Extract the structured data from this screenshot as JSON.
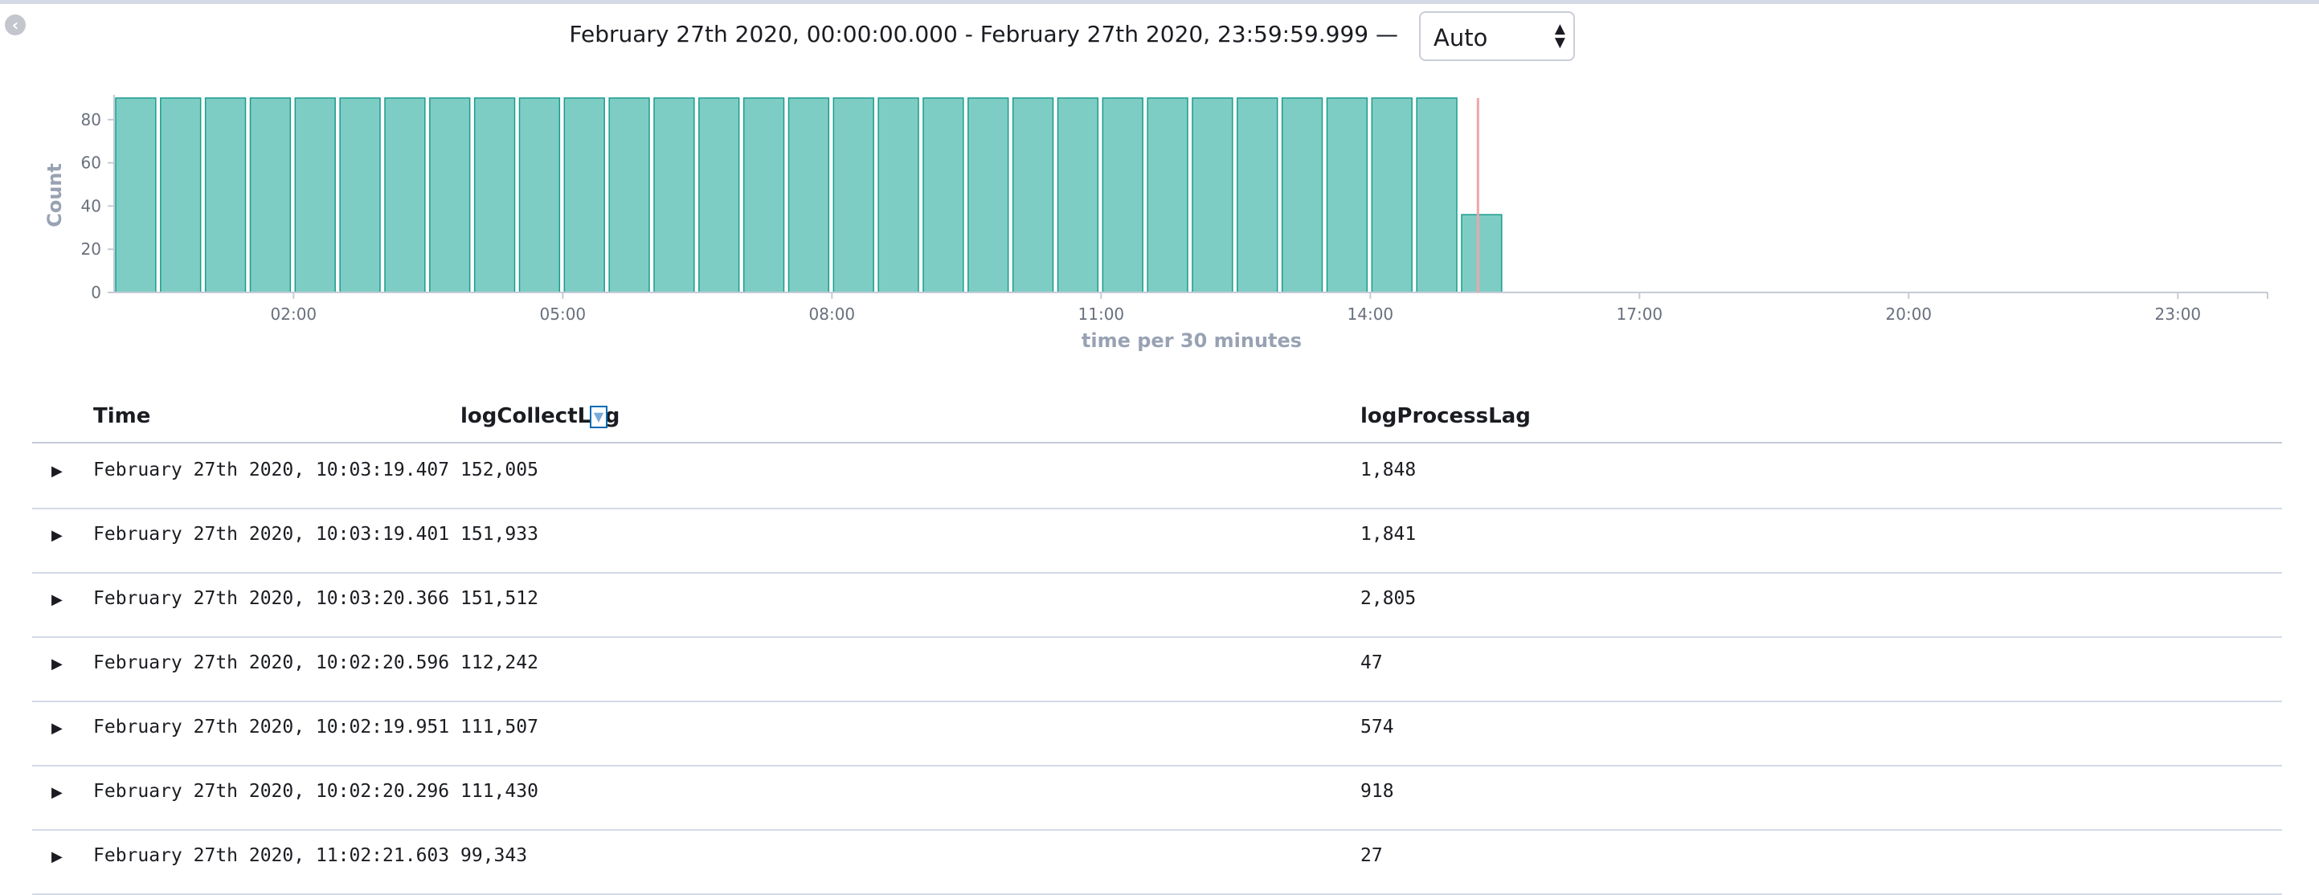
{
  "header": {
    "collapse_icon": "chevron-left-icon",
    "time_range": "February 27th 2020, 00:00:00.000 - February 27th 2020, 23:59:59.999 —",
    "interval": {
      "selected": "Auto",
      "icon": "select-arrows-icon"
    }
  },
  "chart_data": {
    "type": "bar",
    "x_unit": "hours",
    "xlabel": "time per 30 minutes",
    "ylabel": "Count",
    "xlim": [
      0,
      24
    ],
    "ylim": [
      0,
      90
    ],
    "y_ticks": [
      0,
      20,
      40,
      60,
      80
    ],
    "x_ticks": [
      {
        "value": 2,
        "label": "02:00"
      },
      {
        "value": 5,
        "label": "05:00"
      },
      {
        "value": 8,
        "label": "08:00"
      },
      {
        "value": 11,
        "label": "11:00"
      },
      {
        "value": 14,
        "label": "14:00"
      },
      {
        "value": 17,
        "label": "17:00"
      },
      {
        "value": 20,
        "label": "20:00"
      },
      {
        "value": 23,
        "label": "23:00"
      }
    ],
    "bin_width": 0.5,
    "bar_starts": [
      0,
      0.5,
      1,
      1.5,
      2,
      2.5,
      3,
      3.5,
      4,
      4.5,
      5,
      5.5,
      6,
      6.5,
      7,
      7.5,
      8,
      8.5,
      9,
      9.5,
      10,
      10.5,
      11,
      11.5,
      12,
      12.5,
      13,
      13.5,
      14,
      14.5,
      15
    ],
    "values": [
      90,
      90,
      90,
      90,
      90,
      90,
      90,
      90,
      90,
      90,
      90,
      90,
      90,
      90,
      90,
      90,
      90,
      90,
      90,
      90,
      90,
      90,
      90,
      90,
      90,
      90,
      90,
      90,
      90,
      90,
      36
    ],
    "current_time_marker": 15.2,
    "bar_color": "#7ecdc4",
    "bar_border": "#1a9c8e",
    "marker_color": "#f0a5a8",
    "grid": false
  },
  "table": {
    "columns": [
      "Time",
      "logCollectLag",
      "logProcessLag"
    ],
    "sort_icon": "sort-down-icon",
    "expand_icon": "caret-right-icon",
    "rows": [
      {
        "time": "February 27th 2020, 10:03:19.407",
        "logCollectLag": "152,005",
        "logProcessLag": "1,848"
      },
      {
        "time": "February 27th 2020, 10:03:19.401",
        "logCollectLag": "151,933",
        "logProcessLag": "1,841"
      },
      {
        "time": "February 27th 2020, 10:03:20.366",
        "logCollectLag": "151,512",
        "logProcessLag": "2,805"
      },
      {
        "time": "February 27th 2020, 10:02:20.596",
        "logCollectLag": "112,242",
        "logProcessLag": "47"
      },
      {
        "time": "February 27th 2020, 10:02:19.951",
        "logCollectLag": "111,507",
        "logProcessLag": "574"
      },
      {
        "time": "February 27th 2020, 10:02:20.296",
        "logCollectLag": "111,430",
        "logProcessLag": "918"
      },
      {
        "time": "February 27th 2020, 11:02:21.603",
        "logCollectLag": "99,343",
        "logProcessLag": "27"
      }
    ]
  }
}
